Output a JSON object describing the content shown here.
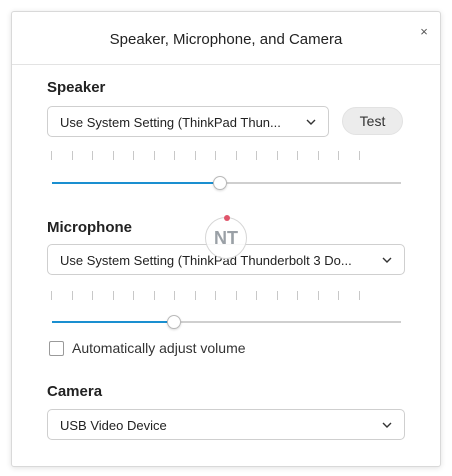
{
  "dialog": {
    "title": "Speaker, Microphone, and Camera",
    "close_glyph": "×"
  },
  "speaker": {
    "label": "Speaker",
    "selected": "Use System Setting (ThinkPad Thun...",
    "test_label": "Test",
    "volume_fraction": 0.48
  },
  "microphone": {
    "label": "Microphone",
    "selected": "Use System Setting (ThinkPad Thunderbolt 3 Do...",
    "level_fraction": 0.35,
    "auto_adjust_label": "Automatically adjust volume",
    "auto_adjust_checked": false
  },
  "camera": {
    "label": "Camera",
    "selected": "USB Video Device"
  },
  "watermark": {
    "text": "NT"
  },
  "colors": {
    "slider_fill": "#1a8fd0",
    "slider_track": "#cfcfcf",
    "watermark_dot": "#e0556b"
  }
}
